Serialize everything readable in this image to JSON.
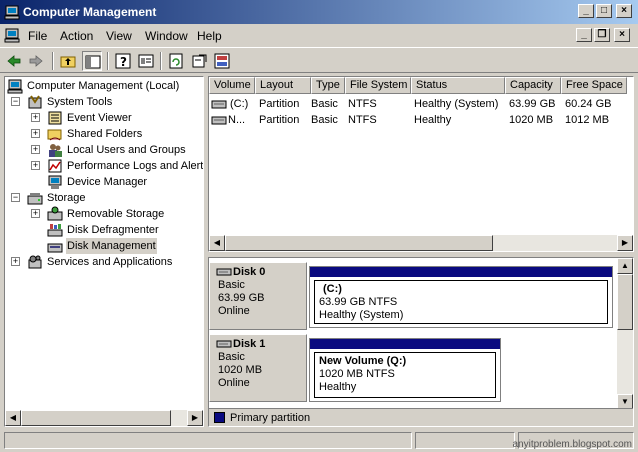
{
  "window": {
    "title": "Computer Management",
    "controls": [
      "_",
      "□",
      "×"
    ]
  },
  "menu": {
    "items": [
      "File",
      "Action",
      "View",
      "Window",
      "Help"
    ],
    "mdi_controls": [
      "_",
      "❐",
      "×"
    ]
  },
  "tree": {
    "root": "Computer Management (Local)",
    "system_tools": "System Tools",
    "event_viewer": "Event Viewer",
    "shared_folders": "Shared Folders",
    "local_users": "Local Users and Groups",
    "perf_logs": "Performance Logs and Alerts",
    "device_manager": "Device Manager",
    "storage": "Storage",
    "removable_storage": "Removable Storage",
    "disk_defrag": "Disk Defragmenter",
    "disk_management": "Disk Management",
    "services_apps": "Services and Applications"
  },
  "volume_list": {
    "columns": [
      "Volume",
      "Layout",
      "Type",
      "File System",
      "Status",
      "Capacity",
      "Free Space"
    ],
    "rows": [
      [
        "(C:)",
        "Partition",
        "Basic",
        "NTFS",
        "Healthy (System)",
        "63.99 GB",
        "60.24 GB"
      ],
      [
        "N...",
        "Partition",
        "Basic",
        "NTFS",
        "Healthy",
        "1020 MB",
        "1012 MB"
      ]
    ]
  },
  "disks": [
    {
      "name": "Disk 0",
      "type": "Basic",
      "size": "63.99 GB",
      "status": "Online",
      "volume": {
        "name": "(C:)",
        "info": "63.99 GB NTFS",
        "status": "Healthy (System)"
      }
    },
    {
      "name": "Disk 1",
      "type": "Basic",
      "size": "1020 MB",
      "status": "Online",
      "volume": {
        "name": "New Volume  (Q:)",
        "info": "1020 MB NTFS",
        "status": "Healthy"
      }
    }
  ],
  "legend": {
    "primary": "Primary partition",
    "primary_color": "#0a0a80"
  },
  "watermark": "anyitproblem.blogspot.com",
  "colors": {
    "titlebar_start": "#0a246a",
    "titlebar_end": "#a6caf0",
    "face": "#d4d0c8"
  }
}
